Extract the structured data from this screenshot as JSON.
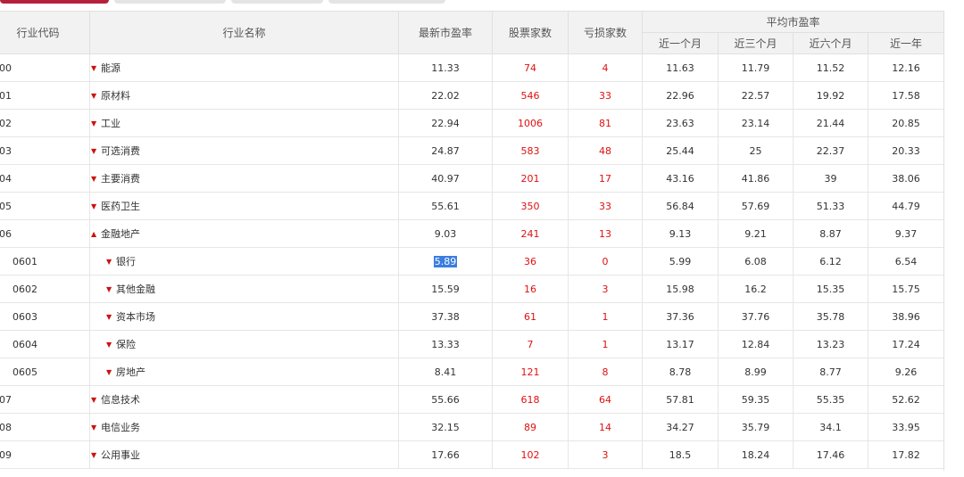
{
  "columns": {
    "code": "行业代码",
    "name": "行业名称",
    "latest_pe": "最新市盈率",
    "stock_count": "股票家数",
    "loss_count": "亏损家数",
    "avg_pe_group": "平均市盈率",
    "avg_1m": "近一个月",
    "avg_3m": "近三个月",
    "avg_6m": "近六个月",
    "avg_1y": "近一年"
  },
  "rows": [
    {
      "code": "00",
      "name": "能源",
      "expanded": false,
      "sub": false,
      "latest_pe": "11.33",
      "stock_count": "74",
      "loss_count": "4",
      "avg_1m": "11.63",
      "avg_3m": "11.79",
      "avg_6m": "11.52",
      "avg_1y": "12.16"
    },
    {
      "code": "01",
      "name": "原材料",
      "expanded": false,
      "sub": false,
      "latest_pe": "22.02",
      "stock_count": "546",
      "loss_count": "33",
      "avg_1m": "22.96",
      "avg_3m": "22.57",
      "avg_6m": "19.92",
      "avg_1y": "17.58"
    },
    {
      "code": "02",
      "name": "工业",
      "expanded": false,
      "sub": false,
      "latest_pe": "22.94",
      "stock_count": "1006",
      "loss_count": "81",
      "avg_1m": "23.63",
      "avg_3m": "23.14",
      "avg_6m": "21.44",
      "avg_1y": "20.85"
    },
    {
      "code": "03",
      "name": "可选消费",
      "expanded": false,
      "sub": false,
      "latest_pe": "24.87",
      "stock_count": "583",
      "loss_count": "48",
      "avg_1m": "25.44",
      "avg_3m": "25",
      "avg_6m": "22.37",
      "avg_1y": "20.33"
    },
    {
      "code": "04",
      "name": "主要消费",
      "expanded": false,
      "sub": false,
      "latest_pe": "40.97",
      "stock_count": "201",
      "loss_count": "17",
      "avg_1m": "43.16",
      "avg_3m": "41.86",
      "avg_6m": "39",
      "avg_1y": "38.06"
    },
    {
      "code": "05",
      "name": "医药卫生",
      "expanded": false,
      "sub": false,
      "latest_pe": "55.61",
      "stock_count": "350",
      "loss_count": "33",
      "avg_1m": "56.84",
      "avg_3m": "57.69",
      "avg_6m": "51.33",
      "avg_1y": "44.79"
    },
    {
      "code": "06",
      "name": "金融地产",
      "expanded": true,
      "sub": false,
      "latest_pe": "9.03",
      "stock_count": "241",
      "loss_count": "13",
      "avg_1m": "9.13",
      "avg_3m": "9.21",
      "avg_6m": "8.87",
      "avg_1y": "9.37"
    },
    {
      "code": "0601",
      "name": "银行",
      "expanded": false,
      "sub": true,
      "selected": true,
      "latest_pe": "5.89",
      "stock_count": "36",
      "loss_count": "0",
      "avg_1m": "5.99",
      "avg_3m": "6.08",
      "avg_6m": "6.12",
      "avg_1y": "6.54"
    },
    {
      "code": "0602",
      "name": "其他金融",
      "expanded": false,
      "sub": true,
      "latest_pe": "15.59",
      "stock_count": "16",
      "loss_count": "3",
      "avg_1m": "15.98",
      "avg_3m": "16.2",
      "avg_6m": "15.35",
      "avg_1y": "15.75"
    },
    {
      "code": "0603",
      "name": "资本市场",
      "expanded": false,
      "sub": true,
      "latest_pe": "37.38",
      "stock_count": "61",
      "loss_count": "1",
      "avg_1m": "37.36",
      "avg_3m": "37.76",
      "avg_6m": "35.78",
      "avg_1y": "38.96"
    },
    {
      "code": "0604",
      "name": "保险",
      "expanded": false,
      "sub": true,
      "latest_pe": "13.33",
      "stock_count": "7",
      "loss_count": "1",
      "avg_1m": "13.17",
      "avg_3m": "12.84",
      "avg_6m": "13.23",
      "avg_1y": "17.24"
    },
    {
      "code": "0605",
      "name": "房地产",
      "expanded": false,
      "sub": true,
      "latest_pe": "8.41",
      "stock_count": "121",
      "loss_count": "8",
      "avg_1m": "8.78",
      "avg_3m": "8.99",
      "avg_6m": "8.77",
      "avg_1y": "9.26"
    },
    {
      "code": "07",
      "name": "信息技术",
      "expanded": false,
      "sub": false,
      "latest_pe": "55.66",
      "stock_count": "618",
      "loss_count": "64",
      "avg_1m": "57.81",
      "avg_3m": "59.35",
      "avg_6m": "55.35",
      "avg_1y": "52.62"
    },
    {
      "code": "08",
      "name": "电信业务",
      "expanded": false,
      "sub": false,
      "latest_pe": "32.15",
      "stock_count": "89",
      "loss_count": "14",
      "avg_1m": "34.27",
      "avg_3m": "35.79",
      "avg_6m": "34.1",
      "avg_1y": "33.95"
    },
    {
      "code": "09",
      "name": "公用事业",
      "expanded": false,
      "sub": false,
      "latest_pe": "17.66",
      "stock_count": "102",
      "loss_count": "3",
      "avg_1m": "18.5",
      "avg_3m": "18.24",
      "avg_6m": "17.46",
      "avg_1y": "17.82"
    }
  ],
  "icons": {
    "collapsed": "caret-down-icon",
    "expanded": "caret-up-icon"
  },
  "colors": {
    "accent": "#b5213d",
    "count_red": "#e01010",
    "arrow_red": "#cc1111",
    "header_bg": "#f2f2f2",
    "selection": "#3b7de0"
  }
}
